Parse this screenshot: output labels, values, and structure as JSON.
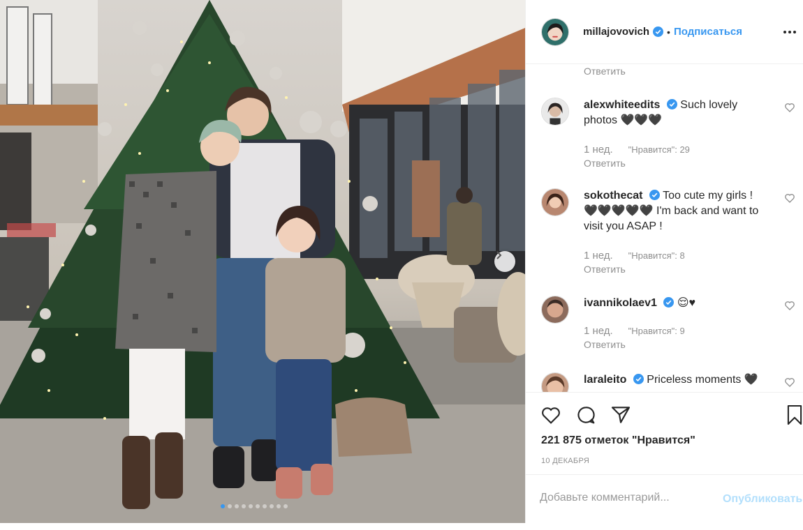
{
  "post": {
    "author": "millajovovich",
    "separator": "•",
    "follow_label": "Подписаться",
    "more_icon": "more-horizontal-icon",
    "reply_label_top": "Ответить",
    "comments": [
      {
        "user": "alexwhiteedits",
        "text": "Such lovely photos 🖤🖤🖤",
        "time": "1 нед.",
        "likes": "\"Нравится\": 29",
        "reply": "Ответить"
      },
      {
        "user": "sokothecat",
        "text": "Too cute my girls ! 🖤🖤🖤🖤🖤 I'm back and want to visit you ASAP !",
        "time": "1 нед.",
        "likes": "\"Нравится\": 8",
        "reply": "Ответить"
      },
      {
        "user": "ivannikolaev1",
        "text": "😌♥",
        "time": "1 нед.",
        "likes": "\"Нравится\": 9",
        "reply": "Ответить"
      },
      {
        "user": "laraleito",
        "text": "Priceless moments 🖤"
      }
    ],
    "likes_total": "221 875 отметок \"Нравится\"",
    "date": "10 ДЕКАБРЯ",
    "comment_placeholder": "Добавьте комментарий...",
    "publish_label": "Опубликовать"
  },
  "carousel": {
    "slides": 10,
    "active_index": 0
  },
  "colors": {
    "accent": "#3897f0",
    "muted": "#8e8e8e",
    "publish_disabled": "#b2dffc"
  }
}
